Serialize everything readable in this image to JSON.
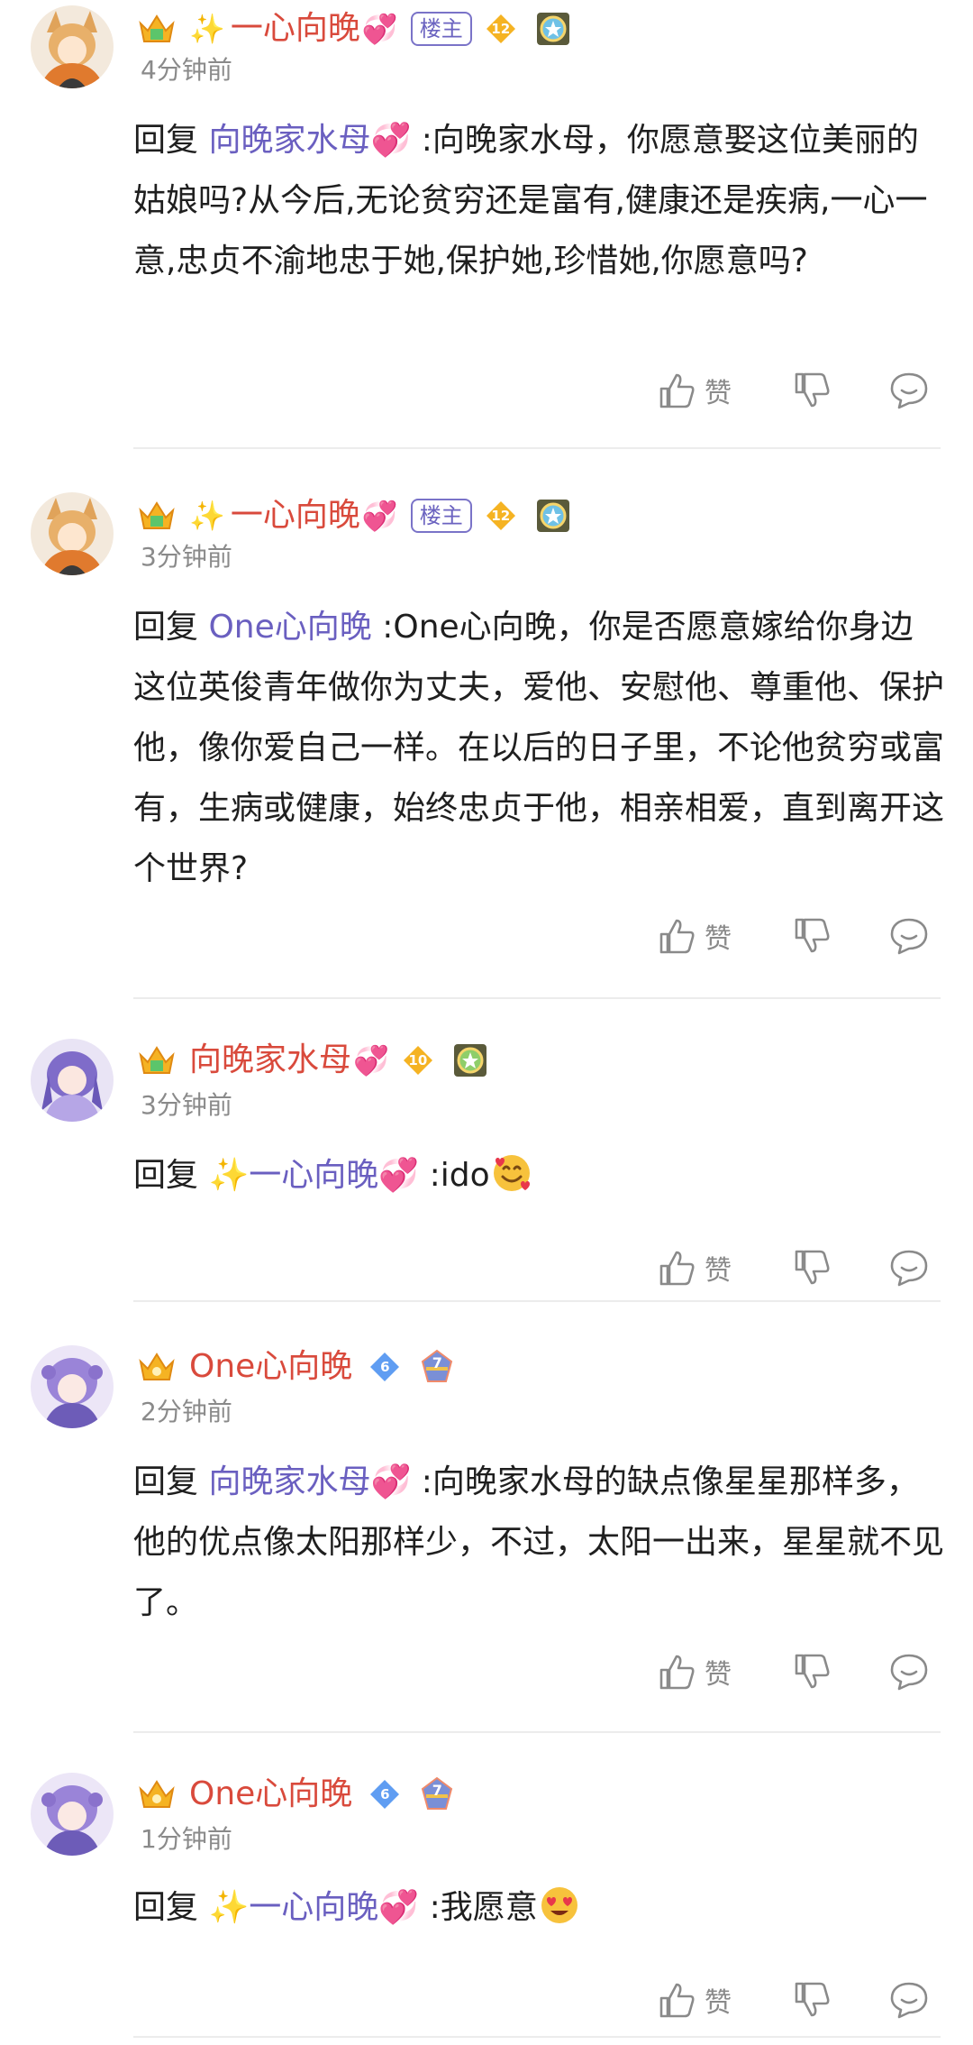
{
  "colors": {
    "username_red": "#d94a3c",
    "reply_target_purple": "#6a5fc0",
    "host_tag_purple": "#6b63c0",
    "time_gray": "#8a8a8a",
    "level_badge_gold": "#f5b323",
    "level_badge_blue": "#5f9df2"
  },
  "icons": {
    "like": "thumbs-up-icon",
    "dislike": "thumbs-down-icon",
    "reply": "comment-bubble-icon",
    "crown": "crown-icon",
    "sparkle": "sparkle-emoji",
    "heart": "two-hearts-emoji",
    "medal": "medal-icon"
  },
  "comments": [
    {
      "username": "一心向晚",
      "has_sparkle": true,
      "has_heart": true,
      "host_tag": "楼主",
      "level": "12",
      "time": "4分钟前",
      "reply_prefix": "回复",
      "reply_target": "向晚家水母",
      "reply_target_sparkle": false,
      "reply_target_heart": true,
      "reply_text": ":向晚家水母，你愿意娶这位美丽的姑娘吗?从今后,无论贫穷还是富有,健康还是疾病,一心一意,忠贞不渝地忠于她,保护她,珍惜她,你愿意吗?",
      "like_label": "赞"
    },
    {
      "username": "一心向晚",
      "has_sparkle": true,
      "has_heart": true,
      "host_tag": "楼主",
      "level": "12",
      "time": "3分钟前",
      "reply_prefix": "回复",
      "reply_target": "One心向晚",
      "reply_target_sparkle": false,
      "reply_target_heart": false,
      "reply_text": ":One心向晚，你是否愿意嫁给你身边这位英俊青年做你为丈夫，爱他、安慰他、尊重他、保护他，像你爱自己一样。在以后的日子里，不论他贫穷或富有，生病或健康，始终忠贞于他，相亲相爱，直到离开这个世界?",
      "like_label": "赞"
    },
    {
      "username": "向晚家水母",
      "has_sparkle": false,
      "has_heart": true,
      "host_tag": "",
      "level": "10",
      "time": "3分钟前",
      "reply_prefix": "回复",
      "reply_target": "一心向晚",
      "reply_target_sparkle": true,
      "reply_target_heart": true,
      "reply_text": ":ido",
      "reply_emoji": "smiling-face-with-hearts-emoji",
      "like_label": "赞"
    },
    {
      "username": "One心向晚",
      "has_sparkle": false,
      "has_heart": false,
      "host_tag": "",
      "level": "6",
      "medal_level": "7",
      "time": "2分钟前",
      "reply_prefix": "回复",
      "reply_target": "向晚家水母",
      "reply_target_sparkle": false,
      "reply_target_heart": true,
      "reply_text": ":向晚家水母的缺点像星星那样多，他的优点像太阳那样少，不过，太阳一出来，星星就不见了。",
      "like_label": "赞"
    },
    {
      "username": "One心向晚",
      "has_sparkle": false,
      "has_heart": false,
      "host_tag": "",
      "level": "6",
      "medal_level": "7",
      "time": "1分钟前",
      "reply_prefix": "回复",
      "reply_target": "一心向晚",
      "reply_target_sparkle": true,
      "reply_target_heart": true,
      "reply_text": ":我愿意",
      "reply_emoji": "heart-eyes-emoji",
      "like_label": "赞"
    }
  ]
}
